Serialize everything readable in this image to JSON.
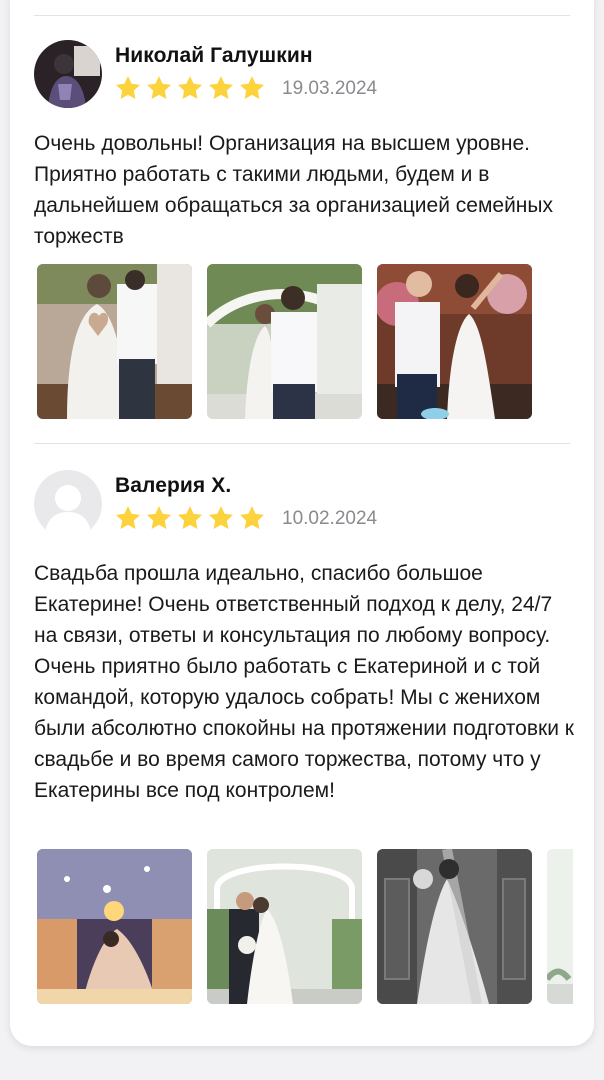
{
  "reviews": [
    {
      "name": "Николай Галушкин",
      "rating": 5,
      "date": "19.03.2024",
      "text": "Очень довольны! Организация на высшем уровне. Приятно работать с такими людьми, будем и в дальнейшем обращаться за организацией семейных торжеств",
      "photo_count": 3
    },
    {
      "name": "Валерия Х.",
      "rating": 5,
      "date": "10.02.2024",
      "text": "Свадьба прошла идеально, спасибо большое Екатерине! Очень ответственный подход к делу, 24/7 на связи, ответы и консультация по любому вопросу. Очень приятно было работать с Екатериной и с той командой, которую удалось собрать! Мы с женихом были абсолютно спокойны на протяжении подготовки к свадьбе и во время самого торжества, потому что у Екатерины все под контролем!",
      "photo_count": 4
    }
  ],
  "colors": {
    "star": "#fcd33d",
    "date": "#8a8a8f",
    "divider": "#e3e3e6"
  }
}
